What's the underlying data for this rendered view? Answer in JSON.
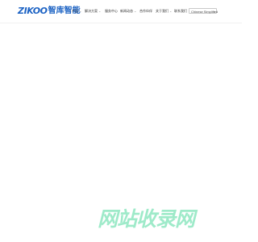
{
  "header": {
    "logo_latin": "ZIKOO",
    "logo_cn": "智库智能",
    "nav": [
      {
        "label": "产品",
        "has_dropdown": true
      },
      {
        "label": "解决方案",
        "has_dropdown": true
      },
      {
        "label": "服务中心",
        "has_dropdown": false
      },
      {
        "label": "新闻动态",
        "has_dropdown": true
      },
      {
        "label": "合作伙伴",
        "has_dropdown": false
      },
      {
        "label": "关于我们",
        "has_dropdown": true
      },
      {
        "label": "联系我们",
        "has_dropdown": false
      }
    ],
    "language": "Chinese Simplified"
  },
  "watermark": "网站收录网",
  "colors": {
    "brand": "#1d63c4",
    "watermark": "#7ee3b8"
  }
}
